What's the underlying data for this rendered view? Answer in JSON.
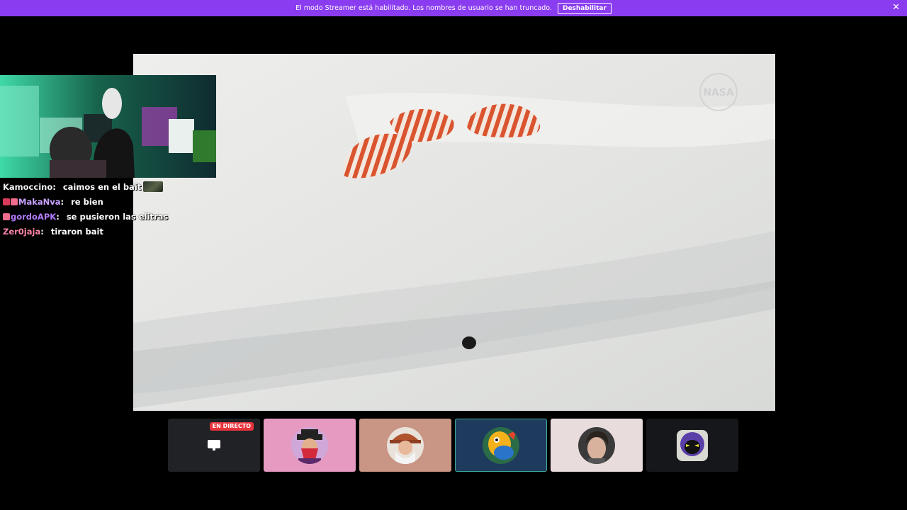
{
  "banner": {
    "message": "El modo Streamer está habilitado. Los nombres de usuario se han truncado.",
    "button_label": "Deshabilitar",
    "close_glyph": "✕"
  },
  "colors": {
    "banner_bg": "#8a3cf0",
    "live_badge": "#e8343d",
    "active_tile_border": "#3fb0a0"
  },
  "video": {
    "watermark": "NASA"
  },
  "chat": {
    "lines": [
      {
        "user": "Kamoccino",
        "sep": ":",
        "message": "caimos en el bait",
        "color": "#f1f1f1"
      },
      {
        "user": "MakaNva",
        "sep": ":",
        "message": "re bien",
        "color": "#c9a2ff"
      },
      {
        "user": "gordoAPK",
        "sep": ":",
        "message": "se pusieron las elitras",
        "color": "#b27cff"
      },
      {
        "user": "Zer0jaja",
        "sep": ":",
        "message": "tiraron bait",
        "color": "#ff86a8"
      }
    ]
  },
  "tiles": {
    "live_label": "EN DIRECTO",
    "items": [
      {
        "bg": "#202225",
        "icon": "screen-share-icon"
      },
      {
        "bg": "#e69ac1",
        "icon": "avatar-bandit"
      },
      {
        "bg": "#c99584",
        "icon": "avatar-old-man"
      },
      {
        "bg": "#1e3a5c",
        "icon": "avatar-cartoon-fish"
      },
      {
        "bg": "#e9dcdc",
        "icon": "avatar-person"
      },
      {
        "bg": "#16171a",
        "icon": "avatar-helmet"
      }
    ]
  }
}
